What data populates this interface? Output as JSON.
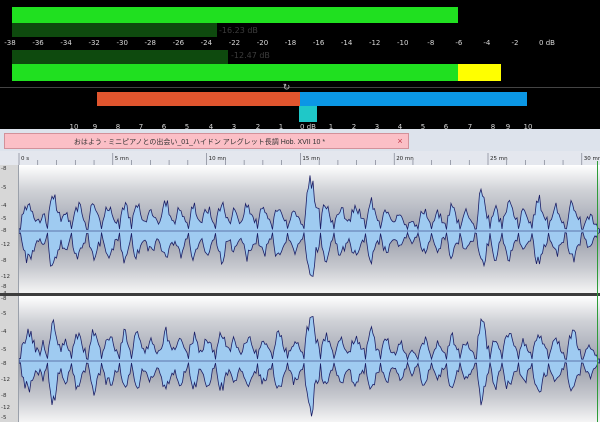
{
  "window": {
    "size_label": "600 x 422"
  },
  "meters": {
    "peak_readout_1": "-16.23 dB",
    "peak_readout_2": "-12.47 dB",
    "level_1": 0.84,
    "level_2": 0.92,
    "peak_1": 0.79,
    "peak_2": 0.6,
    "scale_labels": [
      "-38",
      "-36",
      "-34",
      "-32",
      "-30",
      "-28",
      "-26",
      "-24",
      "-22",
      "-20",
      "-18",
      "-16",
      "-14",
      "-12",
      "-10",
      "-8",
      "-6",
      "-4",
      "-2",
      "0 dB"
    ],
    "colors": {
      "green": "#20e020",
      "dark_green": "#0e4a0e",
      "yellow": "#ffff00",
      "red": "#ff0000"
    }
  },
  "phase_meter": {
    "icon": "loop-icon",
    "scale_labels": [
      "10",
      "9",
      "8",
      "7",
      "6",
      "5",
      "4",
      "3",
      "2",
      "1",
      "0 dB",
      "1",
      "2",
      "3",
      "4",
      "5",
      "6",
      "7",
      "8",
      "9",
      "10"
    ],
    "colors": {
      "left": "#e0552e",
      "right": "#0b97e5",
      "center": "#1fc8c8"
    }
  },
  "tab": {
    "title": "おはよう - ミニピアノとの出会い_01_ハイドン アレグレット長調 Hob. XVII 10 *",
    "close_glyph": "×"
  },
  "ruler": {
    "labels": [
      "0 s",
      "5 mn",
      "10 mn",
      "15 mn",
      "20 mn",
      "25 mn",
      "30 mn"
    ]
  },
  "amplitude_scale": {
    "top_channel": [
      "-8",
      "-5",
      "-4",
      "-5",
      "-8",
      "-12",
      "-8",
      "-12",
      "-8",
      "-4"
    ],
    "bottom_channel": [
      "-8",
      "-5",
      "-4",
      "-5",
      "-8",
      "-12",
      "-8",
      "-12",
      "-5"
    ]
  },
  "waveform": {
    "fill_color": "#9fcbf1",
    "stroke_color": "#1c1f66"
  }
}
